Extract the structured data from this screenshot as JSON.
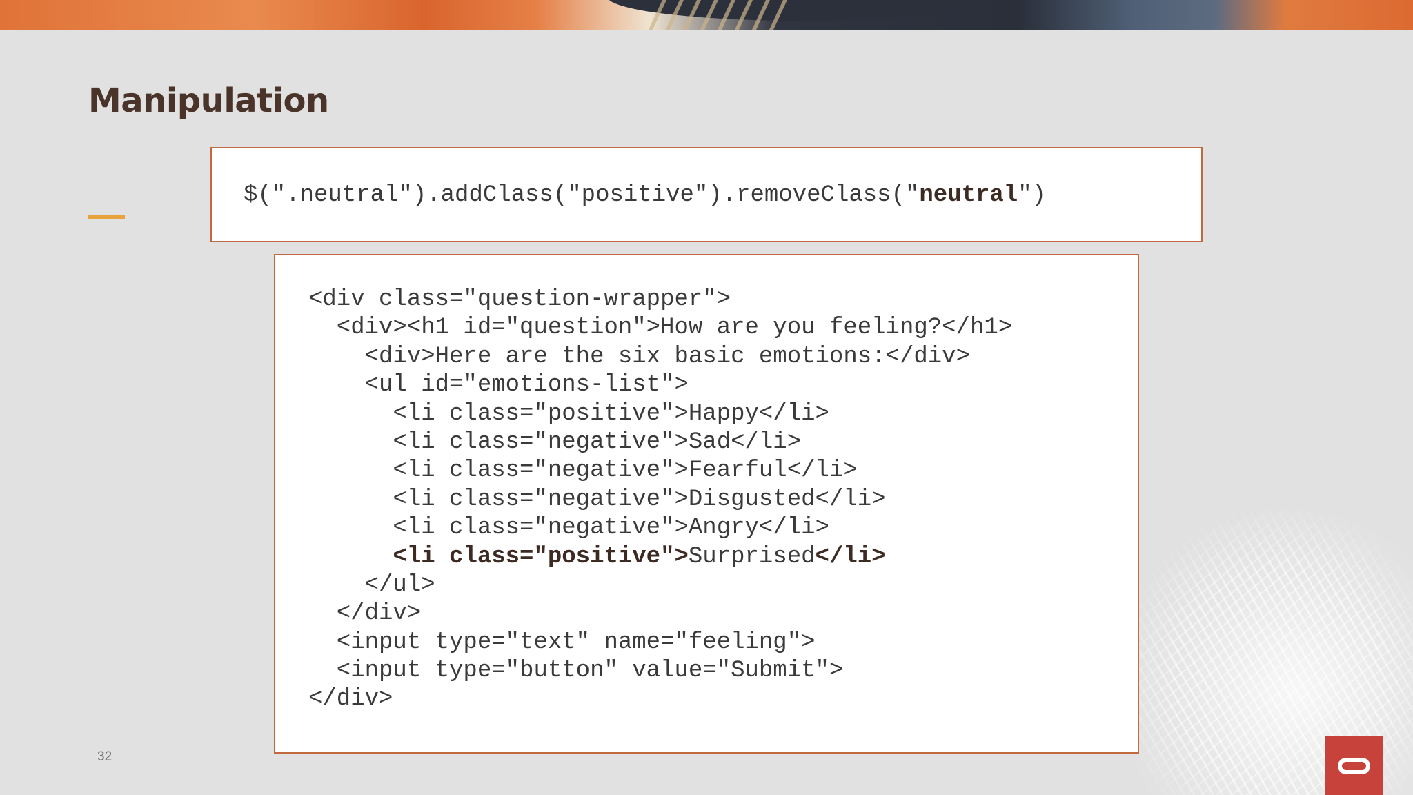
{
  "slide": {
    "title": "Manipulation",
    "page_number": "32"
  },
  "jquery_box": {
    "parts": [
      "$(\".neutral\").addClass(\"positive\").removeClass(\"",
      "neutral",
      "\")"
    ]
  },
  "html_box": {
    "lines": [
      "<div class=\"question-wrapper\">",
      "  <div><h1 id=\"question\">How are you feeling?</h1>",
      "    <div>Here are the six basic emotions:</div>",
      "    <ul id=\"emotions-list\">",
      "      <li class=\"positive\">Happy</li>",
      "      <li class=\"negative\">Sad</li>",
      "      <li class=\"negative\">Fearful</li>",
      "      <li class=\"negative\">Disgusted</li>",
      "      <li class=\"negative\">Angry</li>",
      "    </ul>",
      "  </div>",
      "  <input type=\"text\" name=\"feeling\">",
      "  <input type=\"button\" value=\"Submit\">",
      "</div>"
    ],
    "highlight_line": {
      "indent": "      ",
      "bold_open": "<li class=\"",
      "bold_class": "positive",
      "bold_close_tag": "\">",
      "text": "Surprised",
      "bold_end": "</li>"
    }
  },
  "logo": {
    "icon": "oracle-ring-icon",
    "color": "#c7423b"
  },
  "colors": {
    "title": "#4a3328",
    "accent": "#e8a33d",
    "box_border": "#c2693f",
    "background": "#e1e1e1"
  }
}
